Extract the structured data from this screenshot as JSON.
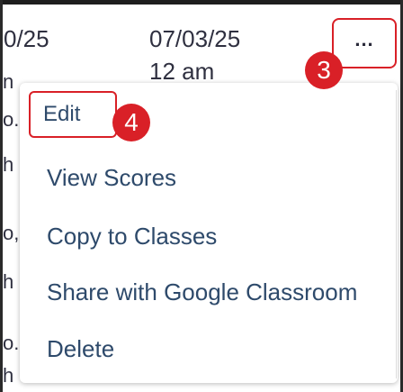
{
  "table": {
    "date_left_fragment": "0/25",
    "date_right": "07/03/25",
    "time_right": "12 am",
    "row_fragments": [
      "n",
      "o.",
      "h",
      "o,",
      "h",
      "o.",
      "h"
    ]
  },
  "more_button": {
    "label": "..."
  },
  "callouts": {
    "step_3": "3",
    "step_4": "4"
  },
  "menu": {
    "items": [
      {
        "label": "Edit"
      },
      {
        "label": "View Scores"
      },
      {
        "label": "Copy to Classes"
      },
      {
        "label": "Share with Google Classroom"
      },
      {
        "label": "Delete"
      }
    ]
  },
  "colors": {
    "callout_red": "#d92027",
    "menu_text": "#2e4a6b"
  }
}
